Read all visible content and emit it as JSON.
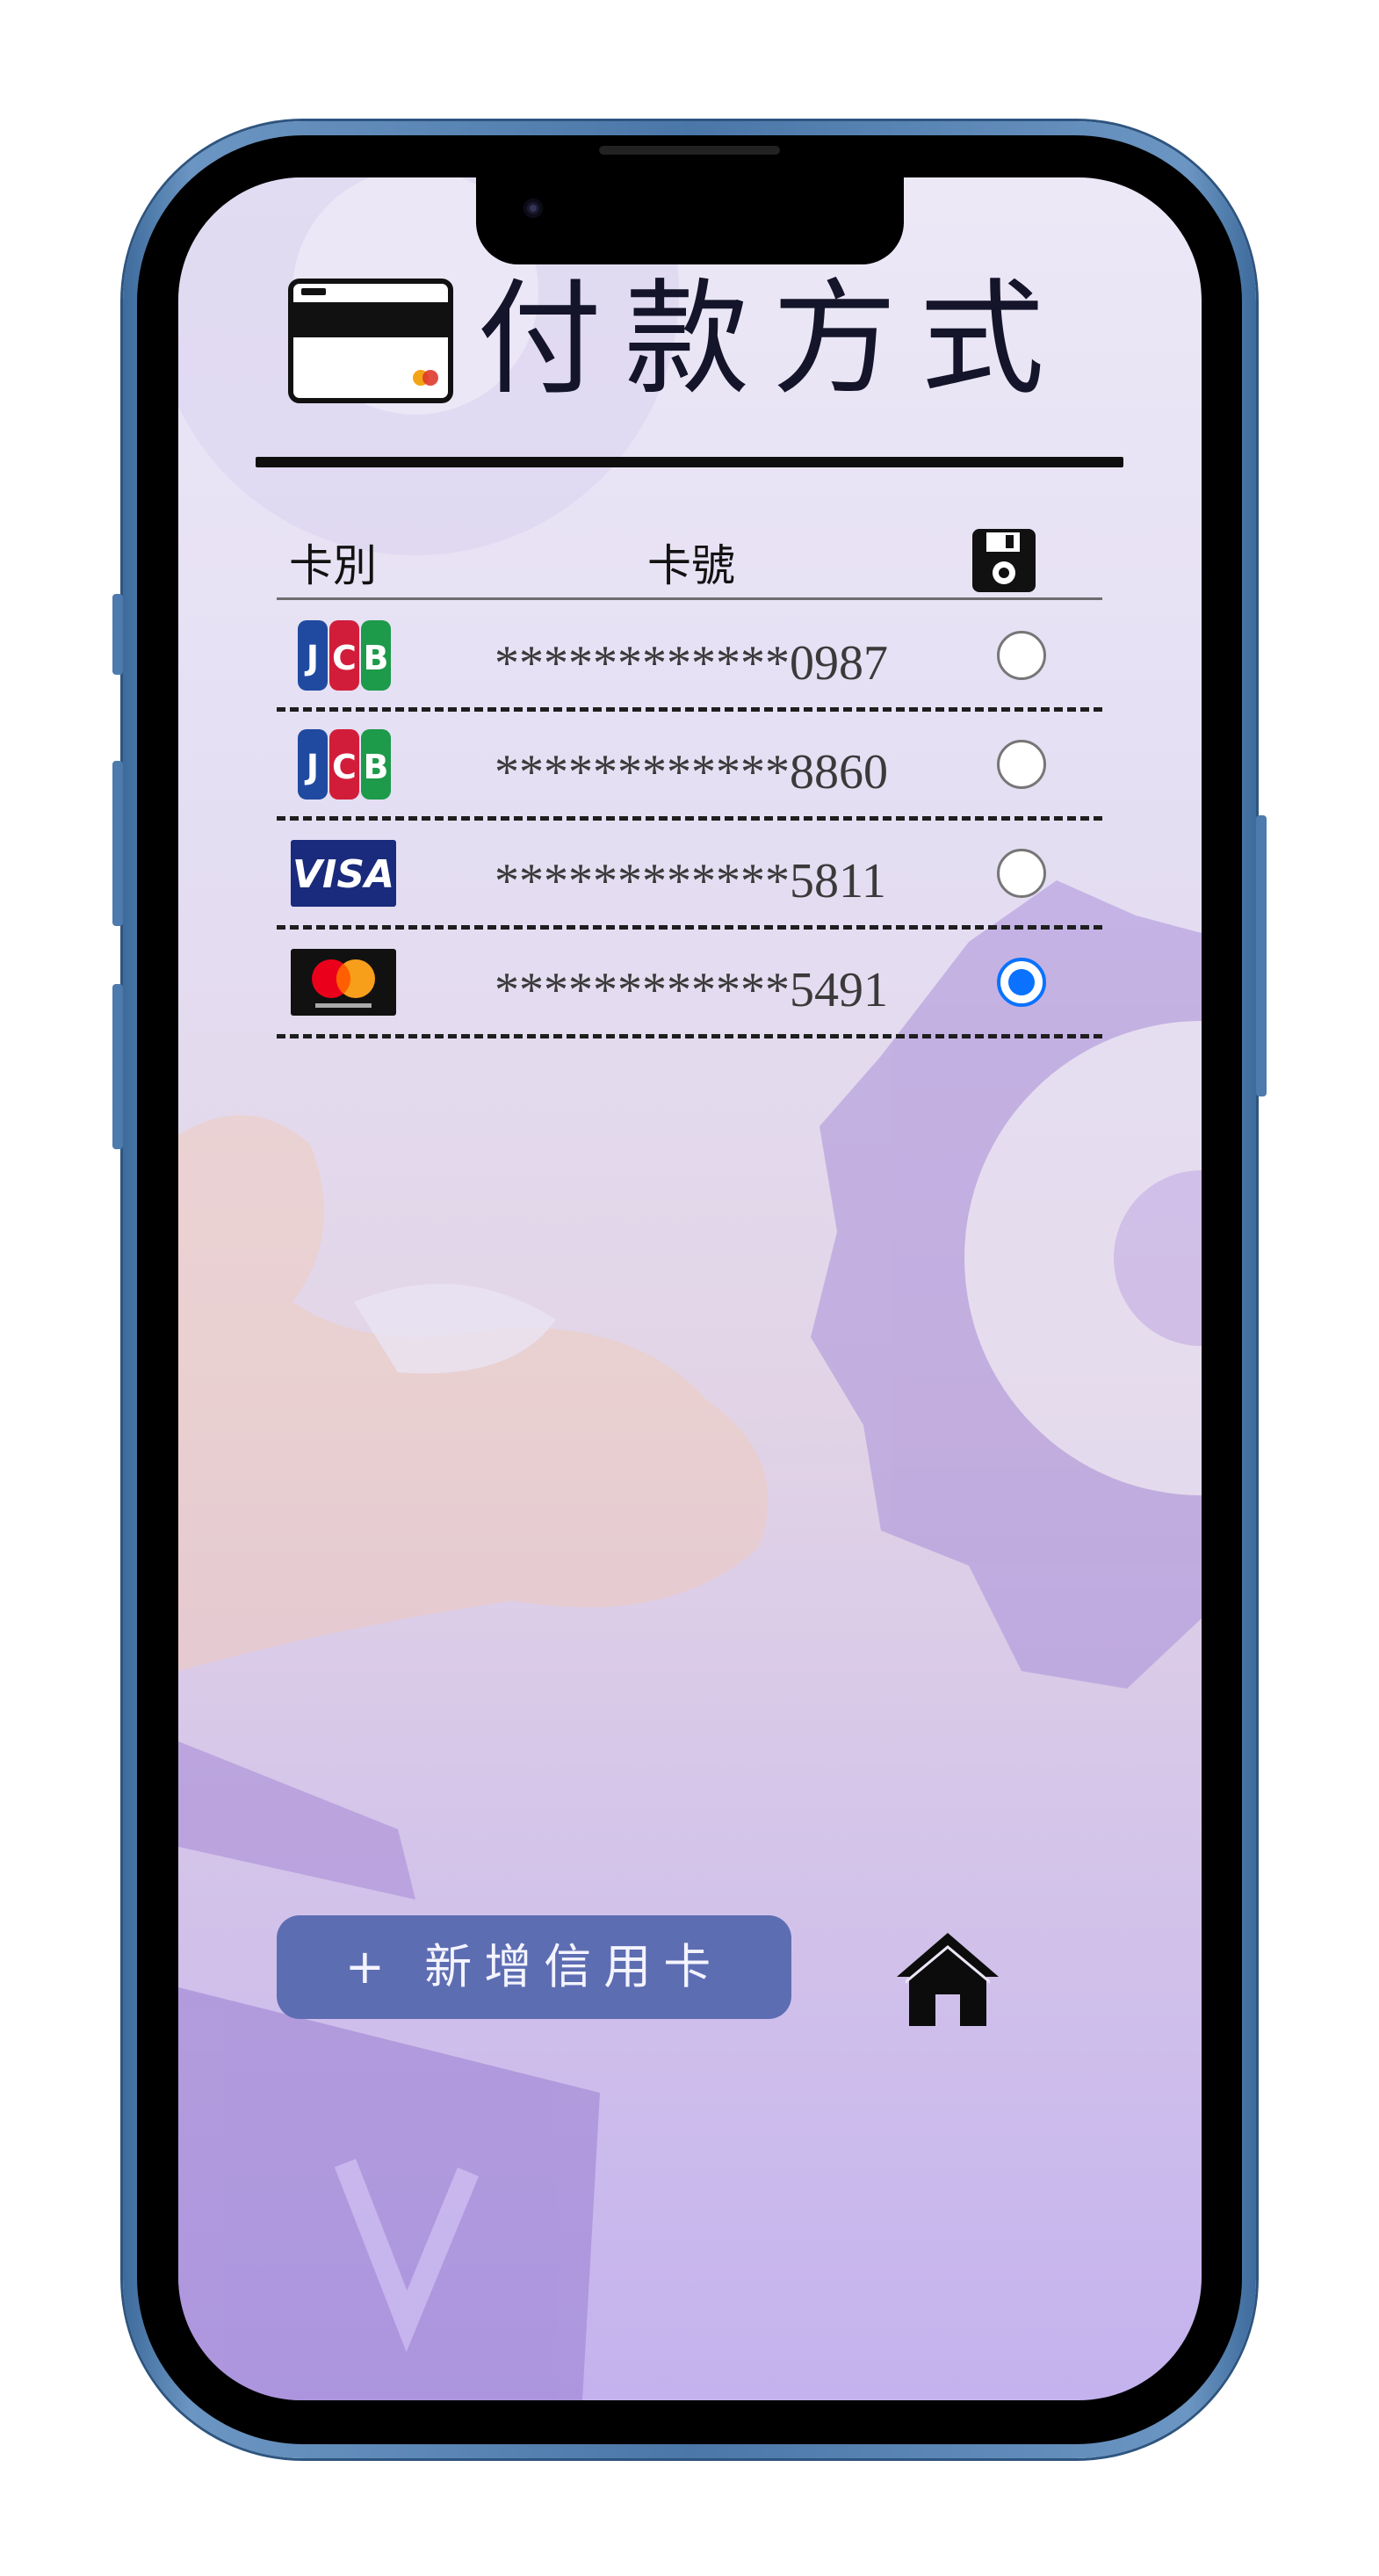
{
  "screen": {
    "title": "付款方式",
    "header_icon": "credit-card-icon"
  },
  "table": {
    "columns": {
      "type": "卡別",
      "number": "卡號",
      "default": "floppy-disk-icon"
    },
    "rows": [
      {
        "brand": "JCB",
        "brand_icon": "jcb-logo-icon",
        "number": "************0987",
        "selected": false
      },
      {
        "brand": "JCB",
        "brand_icon": "jcb-logo-icon",
        "number": "************8860",
        "selected": false
      },
      {
        "brand": "VISA",
        "brand_icon": "visa-logo-icon",
        "number": "************5811",
        "selected": false
      },
      {
        "brand": "Mastercard",
        "brand_icon": "mastercard-logo-icon",
        "number": "************5491",
        "selected": true
      }
    ]
  },
  "actions": {
    "add_card_label": "+ 新增信用卡",
    "home_icon": "home-icon"
  },
  "colors": {
    "accent_button": "#5d6db2",
    "radio_selected": "#0a72ff",
    "phone_frame": "#4a77a8"
  }
}
